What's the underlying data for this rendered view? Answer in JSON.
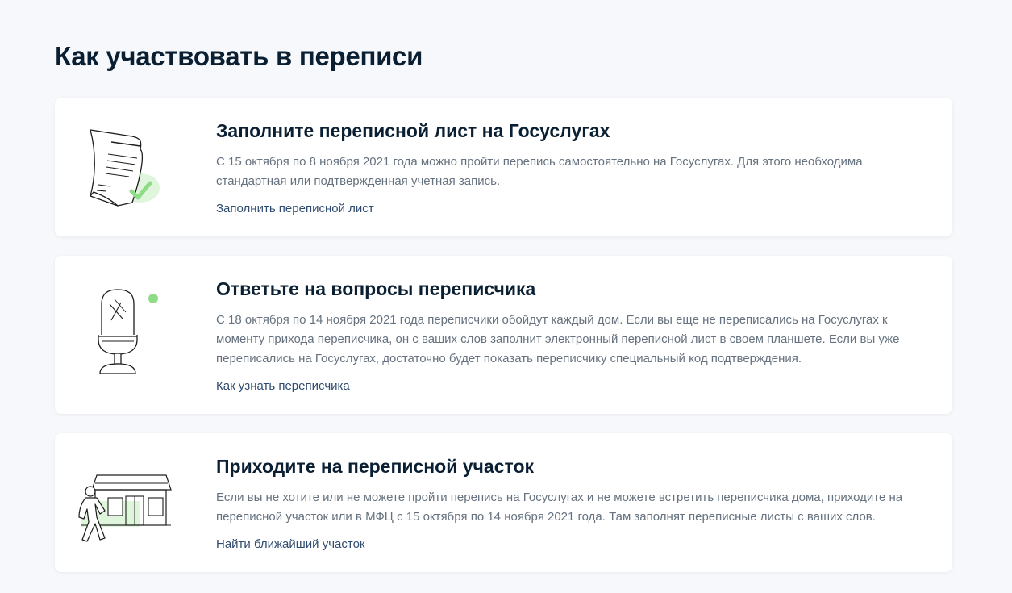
{
  "page": {
    "title": "Как участвовать в переписи"
  },
  "cards": [
    {
      "title": "Заполните переписной лист на Госуслугах",
      "text": "С 15 октября по 8 ноября 2021 года можно пройти перепись самостоятельно на Госуслугах. Для этого необходима стандартная или подтвержденная учетная запись.",
      "link": "Заполнить переписной лист",
      "icon": "document-check-icon"
    },
    {
      "title": "Ответьте на вопросы переписчика",
      "text": "С 18 октября по 14 ноября 2021 года переписчики обойдут каждый дом. Если вы еще не переписались на Госуслугах к моменту прихода переписчика, он с ваших слов заполнит электронный переписной лист в своем планшете. Если вы уже переписались на Госуслугах, достаточно будет показать переписчику специальный код подтверждения.",
      "link": "Как узнать переписчика",
      "icon": "microphone-icon"
    },
    {
      "title": "Приходите на переписной участок",
      "text": "Если вы не хотите или не можете пройти перепись на Госуслугах и не можете встретить переписчика дома, приходите на переписной участок или в МФЦ с 15 октября по 14 ноября 2021 года. Там заполнят переписные листы с ваших слов.",
      "link": "Найти ближайший участок",
      "icon": "census-station-icon"
    }
  ],
  "colors": {
    "background": "#f6f8fb",
    "card": "#ffffff",
    "heading": "#0b1f33",
    "body_text": "#66727f",
    "link": "#2f4c70",
    "accent_green": "#9fe39a"
  }
}
